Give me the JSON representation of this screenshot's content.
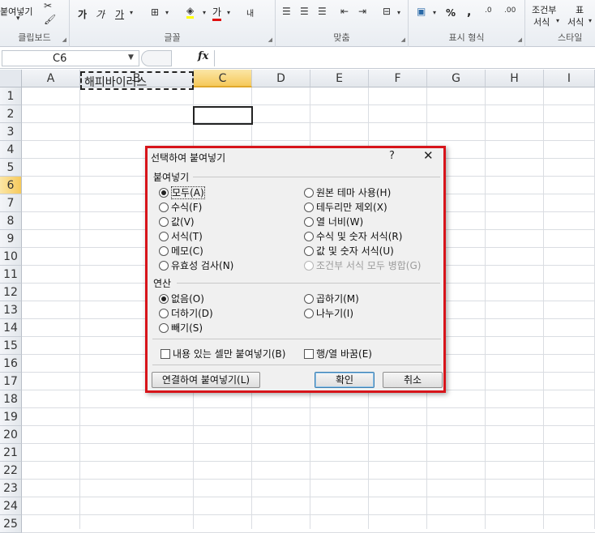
{
  "ribbon": {
    "paste_label": "붙여넣기",
    "clipboard_label": "클립보드",
    "font_label": "글꼴",
    "align_label": "맞춤",
    "number_label": "표시 형식",
    "style_label": "스타일",
    "cond_fmt_label1": "조건부",
    "cond_fmt_label2": "서식",
    "table_label1": "표",
    "table_label2": "서식",
    "bold_icon": "가",
    "italic_icon": "가",
    "underline_icon": "가",
    "fontcolor_icon": "가",
    "wrap_icon": "내",
    "percent": "%",
    "comma": ","
  },
  "formula_bar": {
    "name_box": "C6",
    "fx": "fx",
    "formula": ""
  },
  "columns": [
    "A",
    "B",
    "C",
    "D",
    "E",
    "F",
    "G",
    "H",
    "I"
  ],
  "rows": [
    "1",
    "2",
    "3",
    "4",
    "5",
    "6",
    "7",
    "8",
    "9",
    "10",
    "11",
    "12",
    "13",
    "14",
    "15",
    "16",
    "17",
    "18",
    "19",
    "20",
    "21",
    "22",
    "23",
    "24",
    "25"
  ],
  "cells": {
    "B4": "해피바이러스"
  },
  "dialog": {
    "title": "선택하여 붙여넣기",
    "help": "?",
    "close": "✕",
    "paste_section": "붙여넣기",
    "paste_options_left": [
      "모두(A)",
      "수식(F)",
      "값(V)",
      "서식(T)",
      "메모(C)",
      "유효성 검사(N)"
    ],
    "paste_options_right": [
      "원본 테마 사용(H)",
      "테두리만 제외(X)",
      "열 너비(W)",
      "수식 및 숫자 서식(R)",
      "값 및 숫자 서식(U)",
      "조건부 서식 모두 병합(G)"
    ],
    "operation_section": "연산",
    "operation_left": [
      "없음(O)",
      "더하기(D)",
      "빼기(S)"
    ],
    "operation_right": [
      "곱하기(M)",
      "나누기(I)"
    ],
    "skip_blanks": "내용 있는 셀만 붙여넣기(B)",
    "transpose": "행/열 바꿈(E)",
    "paste_link": "연결하여 붙여넣기(L)",
    "ok": "확인",
    "cancel": "취소"
  }
}
